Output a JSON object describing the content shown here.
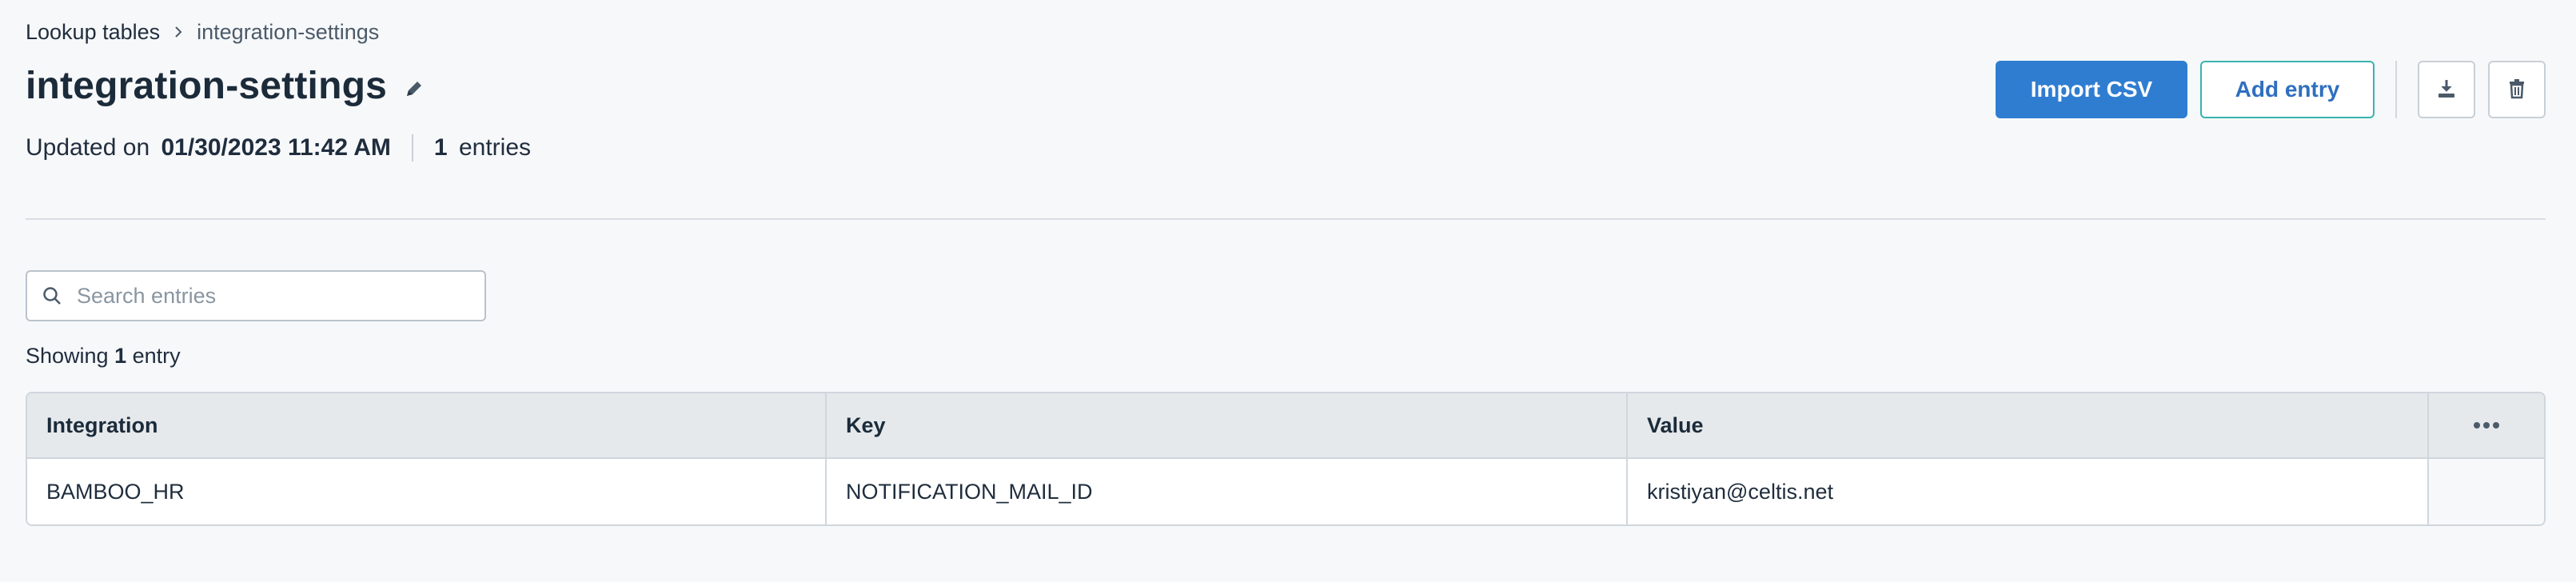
{
  "breadcrumb": {
    "parent": "Lookup tables",
    "current": "integration-settings"
  },
  "header": {
    "title": "integration-settings",
    "updated_prefix": "Updated on",
    "updated_value": "01/30/2023 11:42 AM",
    "entries_count": "1",
    "entries_label": "entries"
  },
  "actions": {
    "import_label": "Import CSV",
    "add_label": "Add entry",
    "download_icon": "download-icon",
    "delete_icon": "trash-icon"
  },
  "search": {
    "placeholder": "Search entries",
    "value": ""
  },
  "results": {
    "prefix": "Showing",
    "count": "1",
    "suffix": "entry"
  },
  "table": {
    "columns": [
      "Integration",
      "Key",
      "Value"
    ],
    "rows": [
      [
        "BAMBOO_HR",
        "NOTIFICATION_MAIL_ID",
        "kristiyan@celtis.net"
      ]
    ]
  },
  "colors": {
    "primary": "#2f7dd1",
    "outline_border": "#39b3ae",
    "background": "#f7f8fa"
  }
}
